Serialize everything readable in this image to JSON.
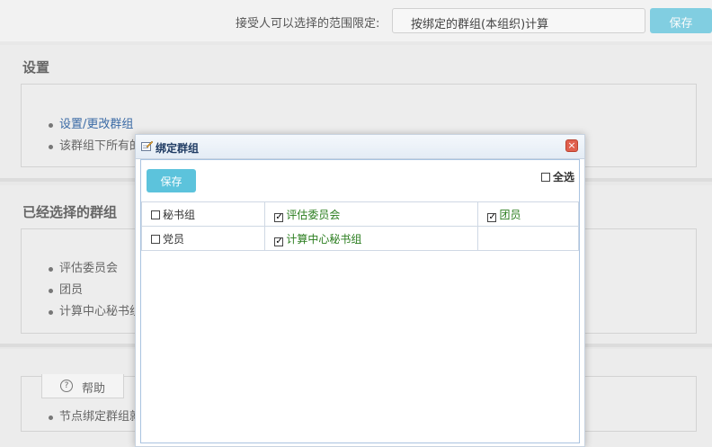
{
  "header": {
    "scope_label": "接受人可以选择的范围限定:",
    "scope_value": "按绑定的群组(本组织)计算",
    "save_label": "保存"
  },
  "settings": {
    "title": "设置",
    "items": [
      "设置/更改群组",
      "该群组下所有的"
    ]
  },
  "selected_groups": {
    "title": "已经选择的群组",
    "items": [
      "评估委员会",
      "团员",
      "计算中心秘书组"
    ]
  },
  "help": {
    "tab_label": "帮助",
    "items": [
      "节点绑定群组就"
    ]
  },
  "dialog": {
    "title": "绑定群组",
    "save_label": "保存",
    "select_all_label": "全选",
    "select_all_checked": false,
    "close_symbol": "×",
    "rows": [
      [
        {
          "label": "秘书组",
          "checked": false
        },
        {
          "label": "评估委员会",
          "checked": true
        },
        {
          "label": "团员",
          "checked": true
        }
      ],
      [
        {
          "label": "党员",
          "checked": false
        },
        {
          "label": "计算中心秘书组",
          "checked": true
        },
        {
          "label": "",
          "checked": false
        }
      ]
    ],
    "checked_color": "#2a7d1e"
  },
  "colors": {
    "accent": "#5cc3dc",
    "link": "#3a6aa5"
  }
}
